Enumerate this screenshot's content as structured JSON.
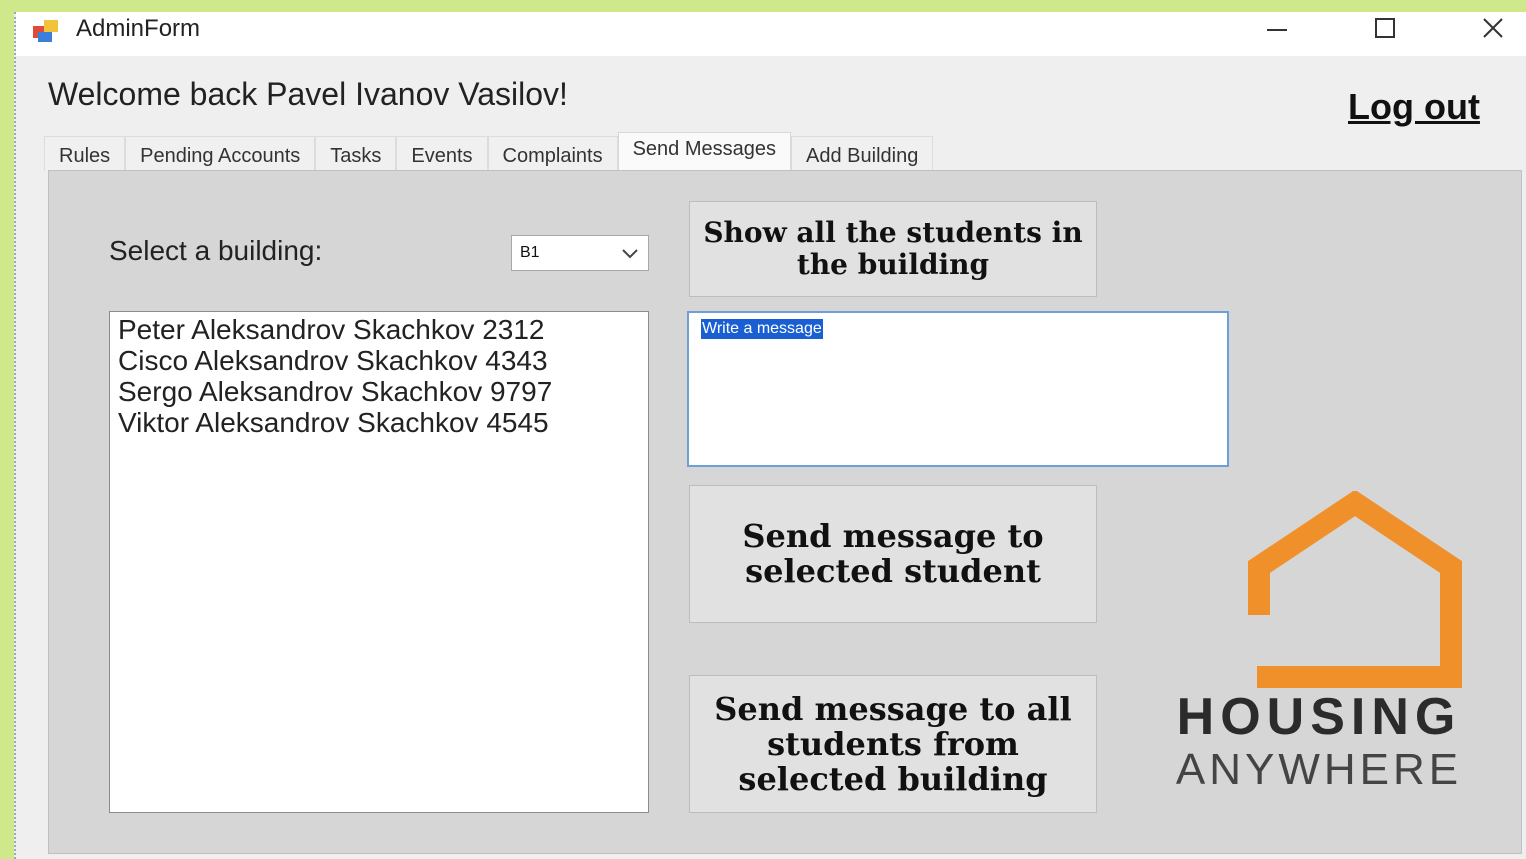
{
  "window": {
    "title": "AdminForm"
  },
  "header": {
    "welcome": "Welcome back Pavel Ivanov Vasilov!",
    "logout": "Log out"
  },
  "tabs": [
    "Rules",
    "Pending Accounts",
    "Tasks",
    "Events",
    "Complaints",
    "Send Messages",
    "Add Building"
  ],
  "active_tab": "Send Messages",
  "send_messages": {
    "building_label": "Select a building:",
    "building_value": "B1",
    "students": [
      "Peter Aleksandrov Skachkov 2312",
      "Cisco Aleksandrov Skachkov 4343",
      "Sergo Aleksandrov Skachkov 9797",
      "Viktor Aleksandrov Skachkov 4545"
    ],
    "show_button": "Show all the students in the building",
    "message_placeholder": "Write a message",
    "send_selected_button": "Send message to selected student",
    "send_all_button": "Send message to all students from selected building"
  },
  "logo": {
    "line1": "HOUSING",
    "line2": "ANYWHERE"
  },
  "colors": {
    "logo_orange": "#f0902a",
    "selection_blue": "#1a5fd1",
    "background_green": "#cfe88c"
  },
  "icons": {
    "minimize": "minimize-icon",
    "maximize": "maximize-icon",
    "close": "close-icon",
    "dropdown": "chevron-down-icon",
    "logo": "house-icon"
  }
}
